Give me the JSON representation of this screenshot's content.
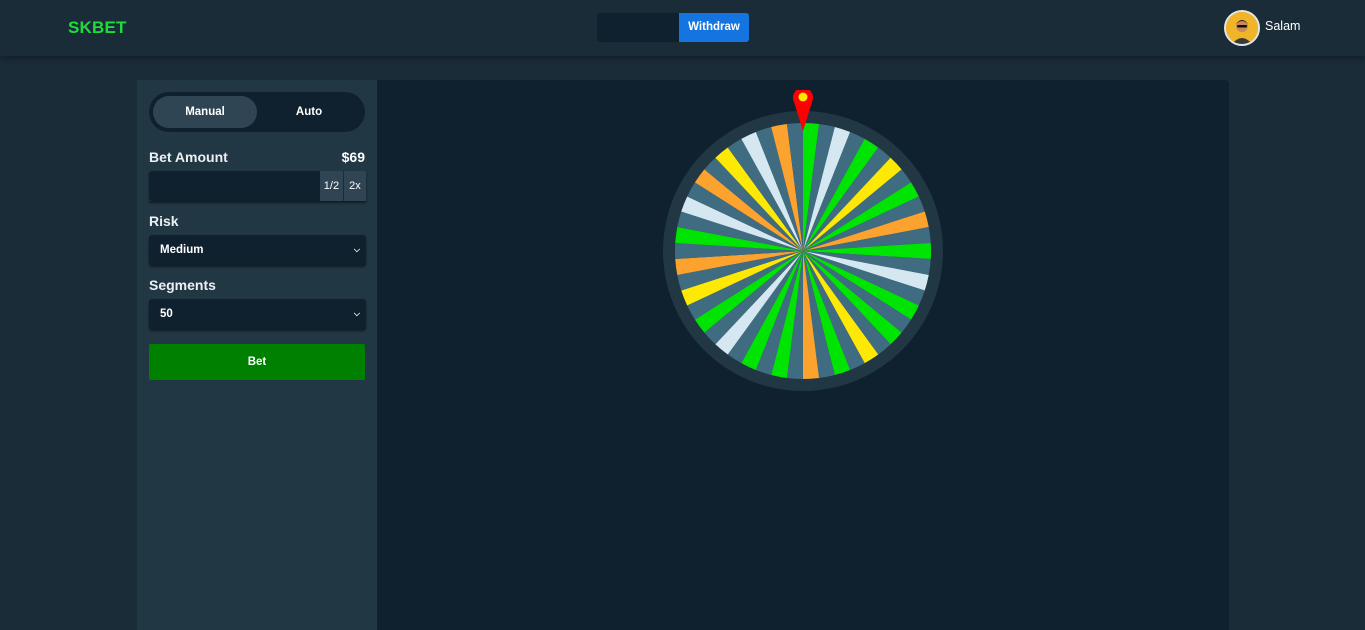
{
  "header": {
    "logo": "SKBET",
    "balance": "",
    "withdraw_label": "Withdraw",
    "username": "Salam"
  },
  "sidebar": {
    "modes": [
      "Manual",
      "Auto"
    ],
    "active_mode": "Manual",
    "bet_amount_label": "Bet Amount",
    "bet_amount_value": "$69",
    "bet_input_value": "",
    "half_label": "1/2",
    "double_label": "2x",
    "risk_label": "Risk",
    "risk_value": "Medium",
    "segments_label": "Segments",
    "segments_value": "50",
    "bet_button_label": "Bet"
  },
  "wheel": {
    "segments": 50,
    "segment_colors": [
      "green",
      "slate",
      "white",
      "slate",
      "green",
      "slate",
      "yellow",
      "slate",
      "green",
      "slate",
      "orange",
      "slate",
      "green",
      "slate",
      "white",
      "slate",
      "green",
      "slate",
      "green",
      "slate",
      "yellow",
      "slate",
      "green",
      "slate",
      "orange",
      "slate",
      "green",
      "slate",
      "green",
      "slate",
      "white",
      "slate",
      "green",
      "slate",
      "yellow",
      "slate",
      "orange",
      "slate",
      "green",
      "slate",
      "white",
      "slate",
      "orange",
      "slate",
      "yellow",
      "slate",
      "white",
      "slate",
      "orange",
      "slate"
    ],
    "colors": {
      "green": "#00e403",
      "slate": "#406c82",
      "white": "#d5e8f2",
      "yellow": "#fde905",
      "orange": "#fca32f",
      "rim": "#213743",
      "pointer": "#ff0000",
      "pointer_dot": "#ffe600"
    }
  },
  "theme": {
    "accent_green": "#1fdc3b",
    "withdraw_blue": "#1475e1",
    "bet_green": "#008000"
  }
}
